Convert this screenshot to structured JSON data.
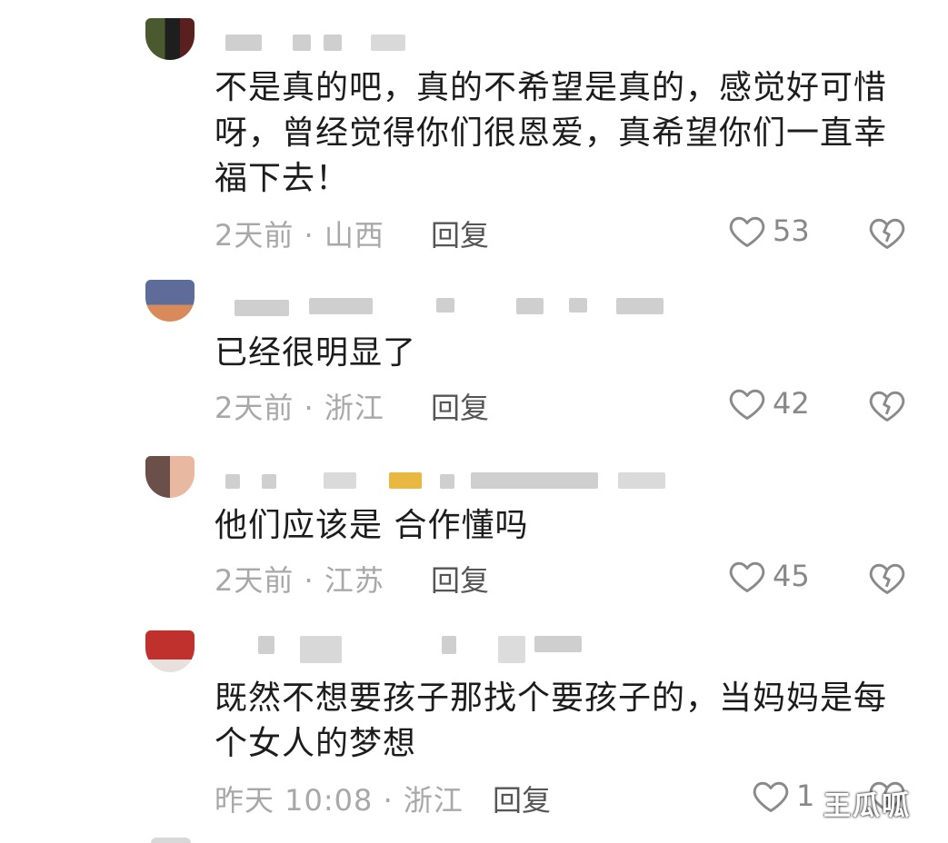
{
  "comments": [
    {
      "text": "不是真的吧，真的不希望是真的，感觉好可惜呀，曾经觉得你们很恩爱，真希望你们一直幸福下去！",
      "meta": "2天前 · 山西",
      "reply": "回复",
      "likes": "53"
    },
    {
      "text": "已经很明显了",
      "meta": "2天前 · 浙江",
      "reply": "回复",
      "likes": "42"
    },
    {
      "text": "他们应该是 合作懂吗",
      "meta": "2天前 · 江苏",
      "reply": "回复",
      "likes": "45"
    },
    {
      "text": "既然不想要孩子那找个要孩子的，当妈妈是每个女人的梦想",
      "meta": "昨天 10:08 · 浙江",
      "reply": "回复",
      "likes": "1"
    }
  ],
  "icons": {
    "like": "heart-outline-icon",
    "dislike": "broken-heart-icon"
  },
  "watermark": "王瓜呱"
}
